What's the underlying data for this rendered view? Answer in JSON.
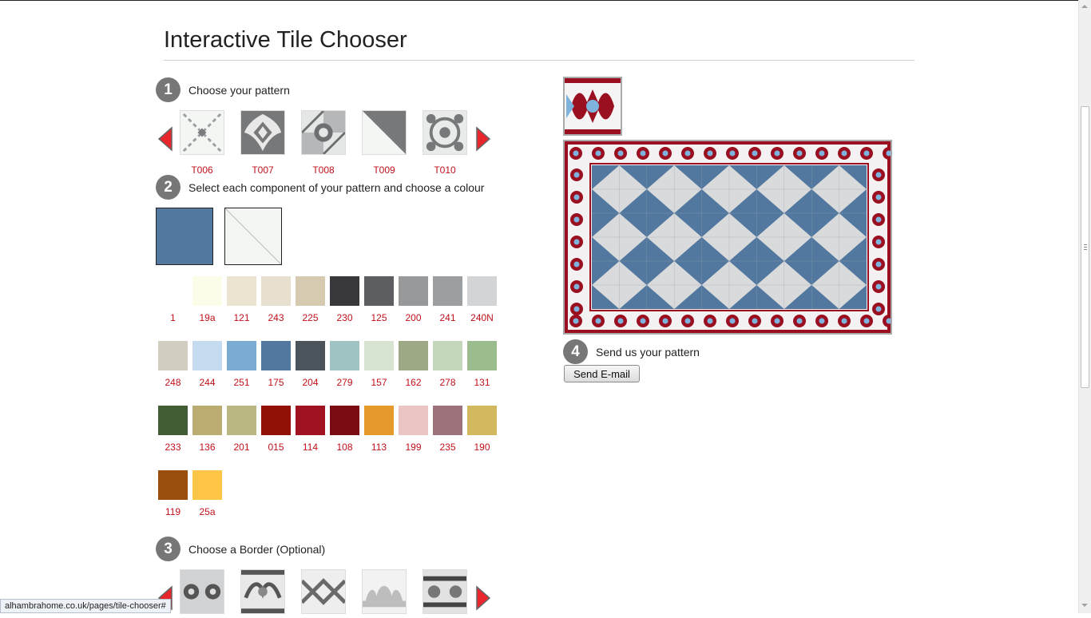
{
  "page": {
    "title": "Interactive Tile Chooser"
  },
  "steps": {
    "s1": {
      "num": "1",
      "label": "Choose your pattern"
    },
    "s2": {
      "num": "2",
      "label": "Select each component of your pattern and choose a colour"
    },
    "s3": {
      "num": "3",
      "label": "Choose a Border (Optional)"
    },
    "s4": {
      "num": "4",
      "label": "Send us your pattern"
    }
  },
  "patterns": [
    "T006",
    "T007",
    "T008",
    "T009",
    "T010"
  ],
  "components": {
    "c1": "#52789f",
    "c2": "#f3f6f3"
  },
  "colours": [
    {
      "code": "1",
      "hex": "#ffffff"
    },
    {
      "code": "19a",
      "hex": "#fbfde9"
    },
    {
      "code": "121",
      "hex": "#ebe4d1"
    },
    {
      "code": "243",
      "hex": "#e8e0cf"
    },
    {
      "code": "225",
      "hex": "#d6cbb0"
    },
    {
      "code": "230",
      "hex": "#38383c"
    },
    {
      "code": "125",
      "hex": "#5d5e61"
    },
    {
      "code": "200",
      "hex": "#98999b"
    },
    {
      "code": "241",
      "hex": "#9b9fa2"
    },
    {
      "code": "240N",
      "hex": "#d3d4d6"
    },
    {
      "code": "248",
      "hex": "#d1cdc1"
    },
    {
      "code": "244",
      "hex": "#c5dbef"
    },
    {
      "code": "251",
      "hex": "#7aabd2"
    },
    {
      "code": "175",
      "hex": "#52789f"
    },
    {
      "code": "204",
      "hex": "#4b535b"
    },
    {
      "code": "279",
      "hex": "#a0c3c3"
    },
    {
      "code": "157",
      "hex": "#d7e4d1"
    },
    {
      "code": "162",
      "hex": "#9da985"
    },
    {
      "code": "278",
      "hex": "#c5d7bb"
    },
    {
      "code": "131",
      "hex": "#9bbd8d"
    },
    {
      "code": "233",
      "hex": "#425c34"
    },
    {
      "code": "136",
      "hex": "#bbac72"
    },
    {
      "code": "201",
      "hex": "#b9b882"
    },
    {
      "code": "015",
      "hex": "#921106"
    },
    {
      "code": "114",
      "hex": "#a0121f"
    },
    {
      "code": "108",
      "hex": "#7c0c14"
    },
    {
      "code": "113",
      "hex": "#e69a2c"
    },
    {
      "code": "199",
      "hex": "#eac5c4"
    },
    {
      "code": "235",
      "hex": "#9d727b"
    },
    {
      "code": "190",
      "hex": "#d2b95f"
    },
    {
      "code": "119",
      "hex": "#994e0d"
    },
    {
      "code": "25a",
      "hex": "#fdc646"
    }
  ],
  "preview": {
    "field_blue": "#52789f",
    "field_grey": "#d8dadb",
    "border_red": "#9a1020",
    "border_blue": "#7eb3de"
  },
  "actions": {
    "send_email": "Send E-mail"
  },
  "status": {
    "url": "alhambrahome.co.uk/pages/tile-chooser#"
  }
}
